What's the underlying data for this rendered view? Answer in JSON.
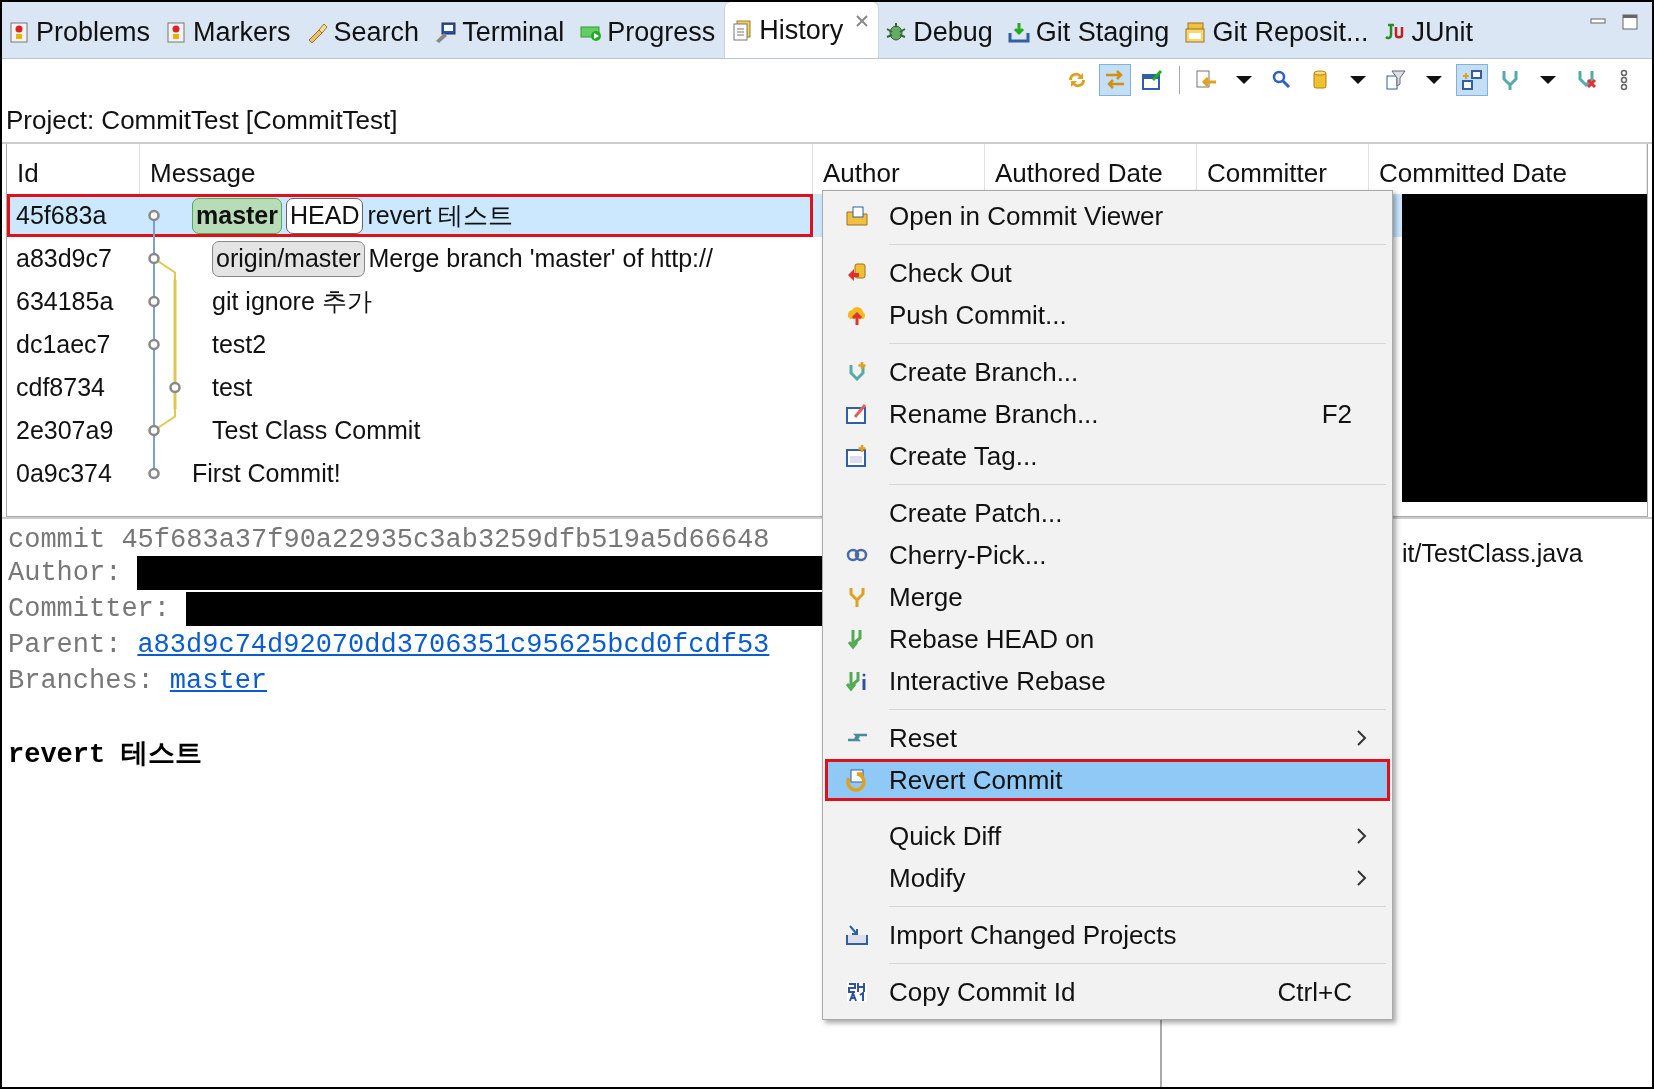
{
  "tabs": [
    {
      "label": "Problems",
      "selected": false,
      "closable": false
    },
    {
      "label": "Markers",
      "selected": false,
      "closable": false
    },
    {
      "label": "Search",
      "selected": false,
      "closable": false
    },
    {
      "label": "Terminal",
      "selected": false,
      "closable": false
    },
    {
      "label": "Progress",
      "selected": false,
      "closable": false
    },
    {
      "label": "History",
      "selected": true,
      "closable": true
    },
    {
      "label": "Debug",
      "selected": false,
      "closable": false
    },
    {
      "label": "Git Staging",
      "selected": false,
      "closable": false
    },
    {
      "label": "Git Reposit...",
      "selected": false,
      "closable": false
    },
    {
      "label": "JUnit",
      "selected": false,
      "closable": false
    }
  ],
  "toolbar": [
    {
      "kind": "sync",
      "pressed": false
    },
    {
      "kind": "compare",
      "pressed": true
    },
    {
      "kind": "link",
      "pressed": false
    },
    {
      "kind": "separator"
    },
    {
      "kind": "filter-folder",
      "pressed": false
    },
    {
      "kind": "dropdown",
      "pressed": false
    },
    {
      "kind": "search",
      "pressed": false
    },
    {
      "kind": "repository",
      "pressed": false
    },
    {
      "kind": "dropdown",
      "pressed": false
    },
    {
      "kind": "filter",
      "pressed": false
    },
    {
      "kind": "dropdown",
      "pressed": false
    },
    {
      "kind": "layout",
      "pressed": true
    },
    {
      "kind": "branches",
      "pressed": false
    },
    {
      "kind": "dropdown",
      "pressed": false
    },
    {
      "kind": "remove",
      "pressed": false
    },
    {
      "kind": "more",
      "pressed": false
    }
  ],
  "project_label": "Project: CommitTest [CommitTest]",
  "table": {
    "columns": [
      "Id",
      "Message",
      "Author",
      "Authored Date",
      "Committer",
      "Committed Date"
    ],
    "rows": [
      {
        "id": "45f683a",
        "kind": "main",
        "side_line": false,
        "refs": [
          {
            "label": "master",
            "kind": "branch"
          },
          {
            "label": "HEAD",
            "kind": "head"
          }
        ],
        "message": "revert 테스트",
        "selected": true,
        "annotated": true
      },
      {
        "id": "a83d9c7",
        "kind": "main",
        "side_line": true,
        "refs": [
          {
            "label": "origin/master",
            "kind": "remote"
          }
        ],
        "message": "Merge branch 'master' of http://",
        "selected": false,
        "annotated": false
      },
      {
        "id": "634185a",
        "kind": "main",
        "side_line": true,
        "refs": [],
        "message": "git ignore 추가",
        "selected": false,
        "annotated": false
      },
      {
        "id": "dc1aec7",
        "kind": "main",
        "side_line": true,
        "refs": [],
        "message": "test2",
        "selected": false,
        "annotated": false
      },
      {
        "id": "cdf8734",
        "kind": "side",
        "side_line": true,
        "refs": [],
        "message": "test",
        "selected": false,
        "annotated": false
      },
      {
        "id": "2e307a9",
        "kind": "main",
        "side_line": true,
        "refs": [],
        "message": "Test Class Commit",
        "selected": false,
        "annotated": false
      },
      {
        "id": "0a9c374",
        "kind": "main",
        "side_line": false,
        "refs": [],
        "message": "First Commit!",
        "selected": false,
        "annotated": false
      }
    ]
  },
  "details": {
    "commit_line": "commit 45f683a37f90a22935c3ab3259dfb519a5d66648",
    "author_label": "Author:",
    "committer_label": "Committer:",
    "parent_label": "Parent:",
    "parent_link": "a83d9c74d92070dd3706351c95625bcd0fcdf53",
    "branches_label": "Branches:",
    "branches_link": "master",
    "message": "revert 테스트",
    "file": "it/TestClass.java"
  },
  "context_menu": {
    "items": [
      {
        "kind": "item",
        "label": "Open in Commit Viewer",
        "selected": false,
        "annotated": false
      },
      {
        "kind": "separator"
      },
      {
        "kind": "item",
        "label": "Check Out",
        "selected": false,
        "annotated": false
      },
      {
        "kind": "item",
        "label": "Push Commit...",
        "selected": false,
        "annotated": false
      },
      {
        "kind": "separator"
      },
      {
        "kind": "item",
        "label": "Create Branch...",
        "selected": false,
        "annotated": false
      },
      {
        "kind": "item",
        "label": "Rename Branch...",
        "shortcut": "F2",
        "selected": false,
        "annotated": false
      },
      {
        "kind": "item",
        "label": "Create Tag...",
        "selected": false,
        "annotated": false
      },
      {
        "kind": "separator"
      },
      {
        "kind": "item",
        "label": "Create Patch...",
        "selected": false,
        "annotated": false
      },
      {
        "kind": "item",
        "label": "Cherry-Pick...",
        "selected": false,
        "annotated": false
      },
      {
        "kind": "item",
        "label": "Merge",
        "selected": false,
        "annotated": false
      },
      {
        "kind": "item",
        "label": "Rebase HEAD on",
        "selected": false,
        "annotated": false
      },
      {
        "kind": "item",
        "label": "Interactive Rebase",
        "selected": false,
        "annotated": false
      },
      {
        "kind": "separator"
      },
      {
        "kind": "item",
        "label": "Reset",
        "submenu": true,
        "selected": false,
        "annotated": false
      },
      {
        "kind": "item",
        "label": "Revert Commit",
        "selected": true,
        "annotated": true
      },
      {
        "kind": "gap"
      },
      {
        "kind": "item",
        "label": "Quick Diff",
        "submenu": true,
        "selected": false,
        "annotated": false
      },
      {
        "kind": "item",
        "label": "Modify",
        "submenu": true,
        "selected": false,
        "annotated": false
      },
      {
        "kind": "separator"
      },
      {
        "kind": "item",
        "label": "Import Changed Projects",
        "selected": false,
        "annotated": false
      },
      {
        "kind": "separator"
      },
      {
        "kind": "item",
        "label": "Copy Commit Id",
        "shortcut": "Ctrl+C",
        "selected": false,
        "annotated": false
      }
    ]
  }
}
